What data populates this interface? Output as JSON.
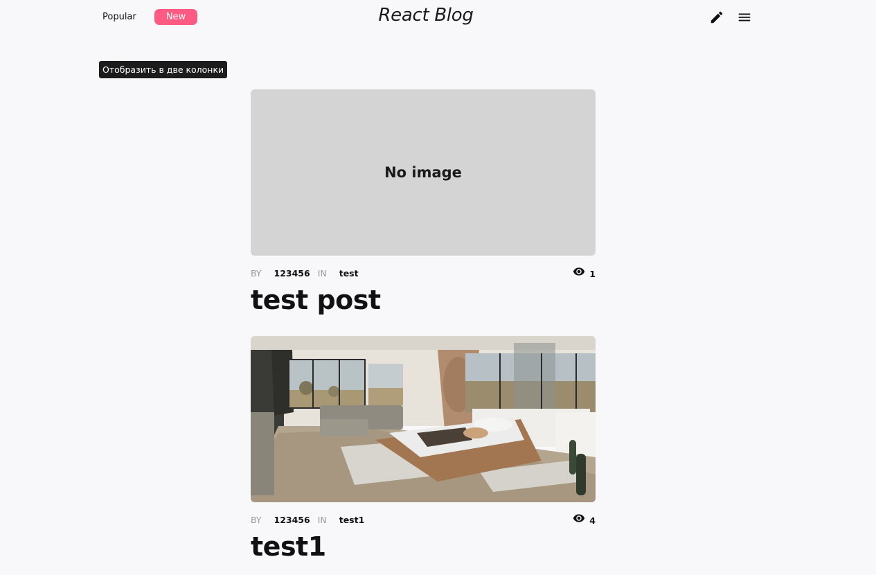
{
  "header": {
    "tabs": [
      {
        "label": "Popular",
        "active": false
      },
      {
        "label": "New",
        "active": true
      }
    ],
    "brand": "React Blog",
    "icons": {
      "edit": "pencil-icon",
      "menu": "hamburger-menu-icon"
    },
    "accent_color": "#ff5a82"
  },
  "tooltip": {
    "text": "Отобразить в две колонки"
  },
  "posts": [
    {
      "image": {
        "placeholder": "No image"
      },
      "by_label": "BY",
      "author": "123456",
      "in_label": "IN",
      "category": "test",
      "views": "1",
      "title": "test post"
    },
    {
      "image": {
        "kind": "interior-bedroom-photo"
      },
      "by_label": "BY",
      "author": "123456",
      "in_label": "IN",
      "category": "test1",
      "views": "4",
      "title": "test1"
    }
  ]
}
